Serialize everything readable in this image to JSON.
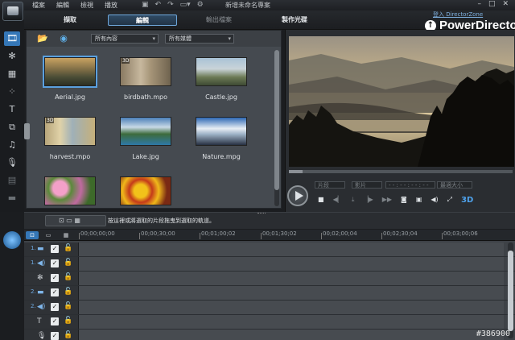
{
  "menu": {
    "items": [
      "檔案",
      "編輯",
      "檢視",
      "播放"
    ],
    "document_title": "新增未命名專案"
  },
  "window_controls": {
    "minimize": "–",
    "maximize": "□",
    "close": "✕"
  },
  "modes": {
    "capture": "擷取",
    "edit": "編輯",
    "produce": "輸出檔案",
    "disc": "製作光碟"
  },
  "brand": {
    "name": "PowerDirector",
    "link": "登入 DirectorZone"
  },
  "library": {
    "filter_content": "所有內容",
    "filter_media": "所有媒體",
    "items": [
      {
        "label": "Aerial.jpg",
        "is3d": false
      },
      {
        "label": "birdbath.mpo",
        "is3d": true
      },
      {
        "label": "Castle.jpg",
        "is3d": false
      },
      {
        "label": "harvest.mpo",
        "is3d": true
      },
      {
        "label": "Lake.jpg",
        "is3d": false
      },
      {
        "label": "Nature.mpg",
        "is3d": false
      },
      {
        "label": "",
        "is3d": false
      },
      {
        "label": "",
        "is3d": false
      }
    ]
  },
  "preview": {
    "segment_clip": "片段",
    "segment_movie": "影片",
    "timecode": "- - : - - : - - : - -",
    "fit": "最適大小",
    "threed": "3D"
  },
  "status": {
    "message": "按這裡或將選取的片段拖曳到選取的軌道。"
  },
  "timeline": {
    "ruler": [
      "00;00;00;00",
      "00;00;30;00",
      "00;01;00;02",
      "00;01;30;02",
      "00;02;00;04",
      "00;02;30;04",
      "00;03;00;06"
    ],
    "tracks": [
      {
        "num": "1.",
        "icon": "video-track-icon"
      },
      {
        "num": "1.",
        "icon": "audio-track-icon"
      },
      {
        "num": "",
        "icon": "effect-track-icon"
      },
      {
        "num": "2.",
        "icon": "video-track-icon"
      },
      {
        "num": "2.",
        "icon": "audio-track-icon"
      },
      {
        "num": "",
        "icon": "title-track-icon"
      },
      {
        "num": "",
        "icon": "voice-track-icon"
      }
    ]
  },
  "watermark": "#386900"
}
